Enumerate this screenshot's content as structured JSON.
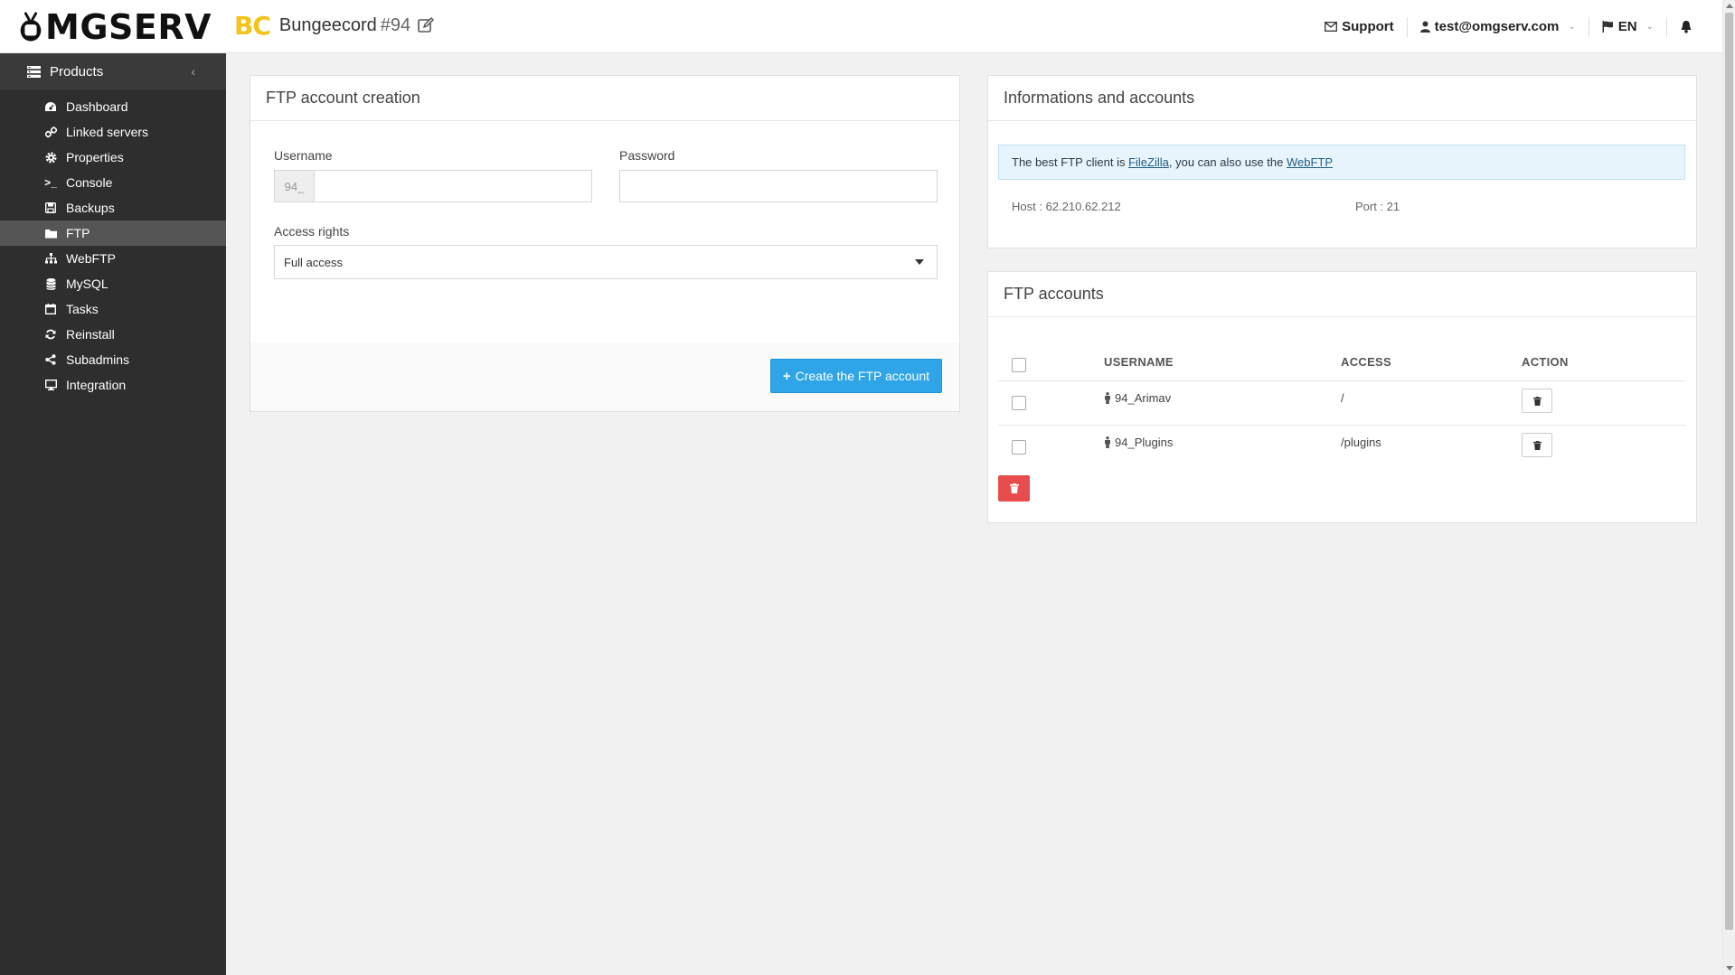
{
  "brand": {
    "logo_text": "MGSERV"
  },
  "product": {
    "badge": "BC",
    "name": "Bungeecord",
    "number": "#94"
  },
  "topbar": {
    "support": "Support",
    "account": "test@omgserv.com",
    "language": "EN"
  },
  "sidebar": {
    "header": "Products",
    "items": [
      {
        "label": "Dashboard",
        "icon": "dashboard-icon"
      },
      {
        "label": "Linked servers",
        "icon": "link-icon"
      },
      {
        "label": "Properties",
        "icon": "gear-icon"
      },
      {
        "label": "Console",
        "icon": "terminal-icon"
      },
      {
        "label": "Backups",
        "icon": "save-icon"
      },
      {
        "label": "FTP",
        "icon": "folder-icon",
        "active": true
      },
      {
        "label": "WebFTP",
        "icon": "sitemap-icon"
      },
      {
        "label": "MySQL",
        "icon": "database-icon"
      },
      {
        "label": "Tasks",
        "icon": "calendar-icon"
      },
      {
        "label": "Reinstall",
        "icon": "refresh-icon"
      },
      {
        "label": "Subadmins",
        "icon": "share-icon"
      },
      {
        "label": "Integration",
        "icon": "monitor-icon"
      }
    ]
  },
  "ftp_create": {
    "title": "FTP account creation",
    "username_label": "Username",
    "username_prefix": "94_",
    "username_value": "",
    "password_label": "Password",
    "password_value": "",
    "access_label": "Access rights",
    "access_value": "Full access",
    "submit_label": "Create the FTP account"
  },
  "info": {
    "title": "Informations and accounts",
    "alert_pre": "The best FTP client is ",
    "alert_link1": "FileZilla",
    "alert_mid": ", you can also use the ",
    "alert_link2": "WebFTP",
    "host": "Host : 62.210.62.212",
    "port": "Port : 21"
  },
  "ftp_accounts": {
    "title": "FTP accounts",
    "columns": [
      "USERNAME",
      "ACCESS",
      "ACTION"
    ],
    "rows": [
      {
        "username": "94_Arimav",
        "access": "/"
      },
      {
        "username": "94_Plugins",
        "access": "/plugins"
      }
    ]
  },
  "colors": {
    "accent": "#2fa4e7",
    "danger": "#e84d4d",
    "sidebar": "#2e2e2e",
    "badge": "#f2c318"
  }
}
